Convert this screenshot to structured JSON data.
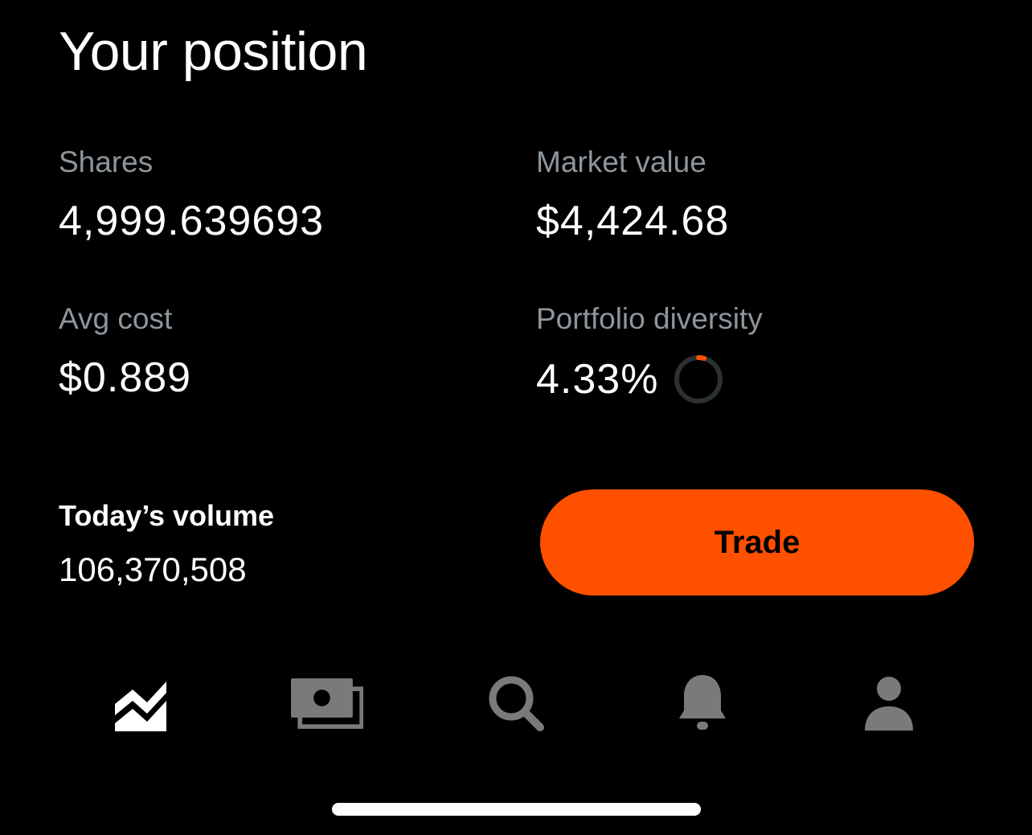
{
  "header": {
    "title": "Your position"
  },
  "stats": {
    "shares": {
      "label": "Shares",
      "value": "4,999.639693"
    },
    "market_value": {
      "label": "Market value",
      "value": "$4,424.68"
    },
    "avg_cost": {
      "label": "Avg cost",
      "value": "$0.889"
    },
    "portfolio_diversity": {
      "label": "Portfolio diversity",
      "value": "4.33%",
      "fraction": 0.0433
    }
  },
  "volume": {
    "label": "Today’s volume",
    "value": "106,370,508"
  },
  "actions": {
    "trade_label": "Trade"
  },
  "bottom_nav": {
    "items": [
      {
        "name": "investing",
        "icon": "chart-icon",
        "active": true
      },
      {
        "name": "cash",
        "icon": "cash-icon",
        "active": false
      },
      {
        "name": "search",
        "icon": "search-icon",
        "active": false
      },
      {
        "name": "notifications",
        "icon": "bell-icon",
        "active": false
      },
      {
        "name": "account",
        "icon": "person-icon",
        "active": false
      }
    ]
  },
  "colors": {
    "background": "#000000",
    "accent": "#ff5000",
    "label_gray": "#8e969c",
    "icon_inactive": "#7a7a7a",
    "ring_track": "#2b3033"
  }
}
